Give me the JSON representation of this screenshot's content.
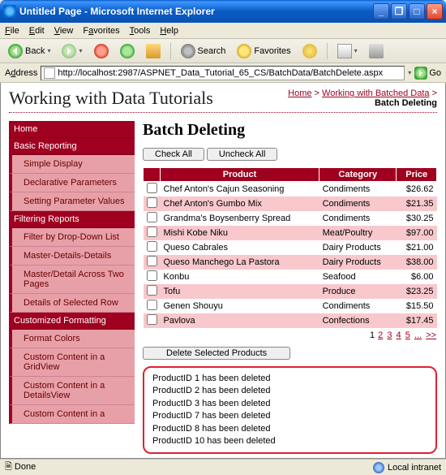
{
  "window": {
    "title": "Untitled Page - Microsoft Internet Explorer"
  },
  "menu": {
    "file": "File",
    "edit": "Edit",
    "view": "View",
    "favorites": "Favorites",
    "tools": "Tools",
    "help": "Help"
  },
  "toolbar": {
    "back": "Back",
    "search": "Search",
    "favorites": "Favorites"
  },
  "address": {
    "label": "Address",
    "url": "http://localhost:2987/ASPNET_Data_Tutorial_65_CS/BatchData/BatchDelete.aspx",
    "go": "Go"
  },
  "header": {
    "site_title": "Working with Data Tutorials",
    "bc_home": "Home",
    "bc_section": "Working with Batched Data",
    "bc_current": "Batch Deleting"
  },
  "nav": {
    "cat0": "Home",
    "cat1": "Basic Reporting",
    "cat1_items": [
      "Simple Display",
      "Declarative Parameters",
      "Setting Parameter Values"
    ],
    "cat2": "Filtering Reports",
    "cat2_items": [
      "Filter by Drop-Down List",
      "Master-Details-Details",
      "Master/Detail Across Two Pages",
      "Details of Selected Row"
    ],
    "cat3": "Customized Formatting",
    "cat3_items": [
      "Format Colors",
      "Custom Content in a GridView",
      "Custom Content in a DetailsView",
      "Custom Content in a"
    ]
  },
  "main": {
    "heading": "Batch Deleting",
    "check_all": "Check All",
    "uncheck_all": "Uncheck All",
    "delete_btn": "Delete Selected Products",
    "cols": {
      "product": "Product",
      "category": "Category",
      "price": "Price"
    },
    "rows": [
      {
        "product": "Chef Anton's Cajun Seasoning",
        "category": "Condiments",
        "price": "$26.62"
      },
      {
        "product": "Chef Anton's Gumbo Mix",
        "category": "Condiments",
        "price": "$21.35"
      },
      {
        "product": "Grandma's Boysenberry Spread",
        "category": "Condiments",
        "price": "$30.25"
      },
      {
        "product": "Mishi Kobe Niku",
        "category": "Meat/Poultry",
        "price": "$97.00"
      },
      {
        "product": "Queso Cabrales",
        "category": "Dairy Products",
        "price": "$21.00"
      },
      {
        "product": "Queso Manchego La Pastora",
        "category": "Dairy Products",
        "price": "$38.00"
      },
      {
        "product": "Konbu",
        "category": "Seafood",
        "price": "$6.00"
      },
      {
        "product": "Tofu",
        "category": "Produce",
        "price": "$23.25"
      },
      {
        "product": "Genen Shouyu",
        "category": "Condiments",
        "price": "$15.50"
      },
      {
        "product": "Pavlova",
        "category": "Confections",
        "price": "$17.45"
      }
    ],
    "pager": {
      "p1": "1",
      "p2": "2",
      "p3": "3",
      "p4": "4",
      "p5": "5",
      "dots": "...",
      "next": ">>"
    },
    "messages": [
      "ProductID 1 has been deleted",
      "ProductID 2 has been deleted",
      "ProductID 3 has been deleted",
      "ProductID 7 has been deleted",
      "ProductID 8 has been deleted",
      "ProductID 10 has been deleted"
    ]
  },
  "status": {
    "left": "Done",
    "right": "Local intranet"
  }
}
